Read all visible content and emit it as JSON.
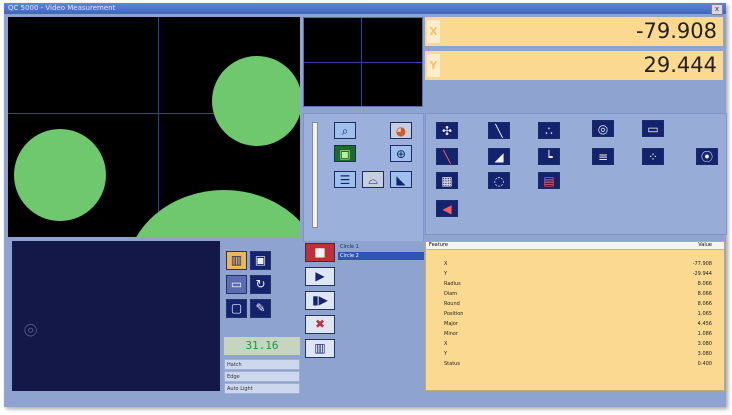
{
  "window": {
    "title": "QC 5000 - Video Measurement",
    "close_glyph": "x"
  },
  "dro": {
    "x_axis": "X",
    "y_axis": "Y",
    "x_value": "-79.908",
    "y_value": "29.444"
  },
  "readout": {
    "value": "31.16"
  },
  "small_fields": [
    "Hatch",
    "Edge",
    "Auto Light"
  ],
  "feature_list": {
    "item_1": "Circle 1",
    "item_2": "Circle 2"
  },
  "results": {
    "header_name": "Feature",
    "header_value": "Value",
    "rows": [
      {
        "name": "X",
        "value": "-77.908"
      },
      {
        "name": "Y",
        "value": "-29.944"
      },
      {
        "name": "Radius",
        "value": "8.066"
      },
      {
        "name": "Diam",
        "value": "8.066"
      },
      {
        "name": "Round",
        "value": "8.066"
      },
      {
        "name": "Position",
        "value": "1.065"
      },
      {
        "name": "Major",
        "value": "4.456"
      },
      {
        "name": "Minor",
        "value": "1.086"
      },
      {
        "name": "X",
        "value": "3.080"
      },
      {
        "name": "Y",
        "value": "3.080"
      },
      {
        "name": "Status",
        "value": "0.400"
      }
    ]
  },
  "icons": {
    "zoom": "magnifier-icon",
    "color_wheel": "color-wheel-icon",
    "light": "lighting-icon",
    "crosshair": "crosshair-icon"
  },
  "colors": {
    "dro_bg": "#fbd991",
    "video_bg": "#000000",
    "feature_green": "#6fc86e",
    "panel_blue": "#8ea3d0",
    "camera_bg": "#131848",
    "readout_green": "#1a9a3b"
  }
}
